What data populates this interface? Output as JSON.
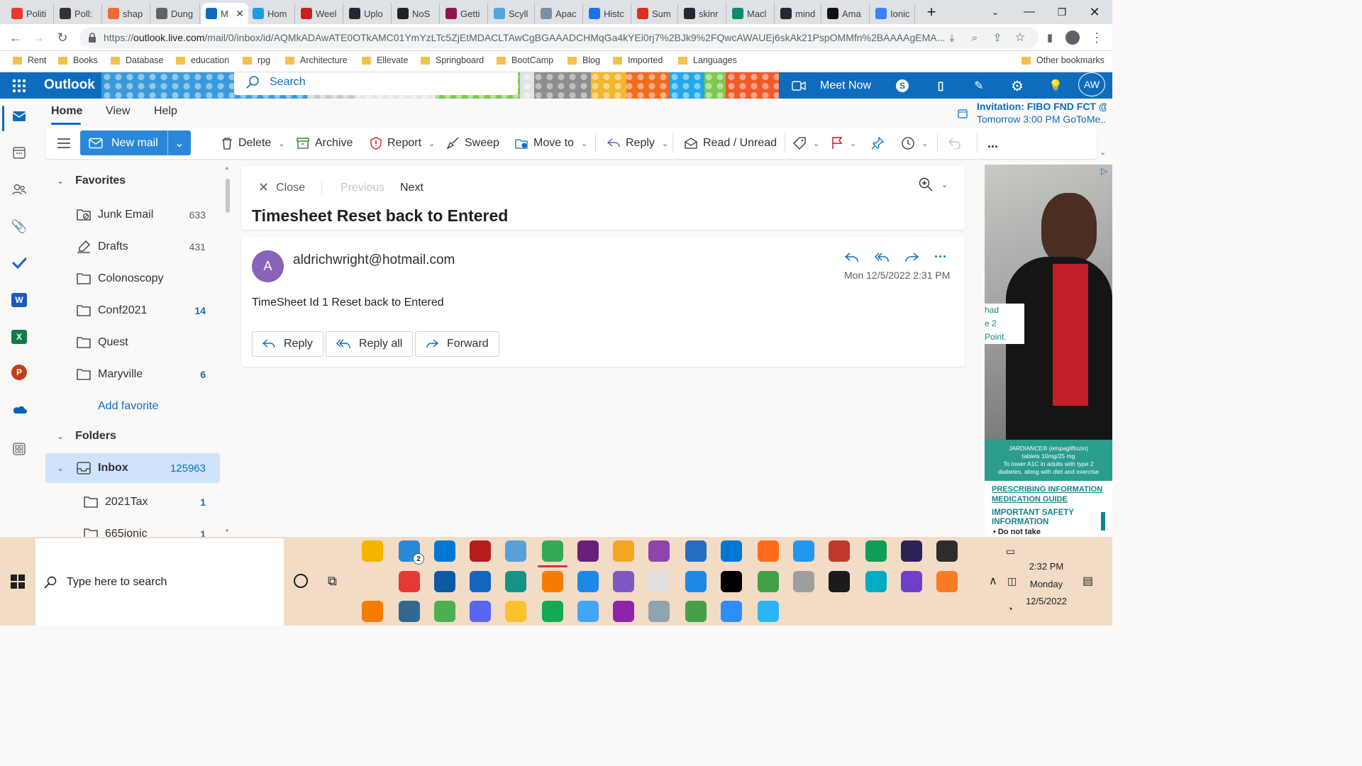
{
  "browser": {
    "tabs": [
      {
        "label": "Politi",
        "favicon": "P",
        "color": "#e63a2e",
        "active": false
      },
      {
        "label": "Poll:",
        "favicon": "hat",
        "color": "#333333",
        "active": false
      },
      {
        "label": "shap",
        "favicon": "e",
        "color": "#ef6b3a",
        "active": false
      },
      {
        "label": "Dung",
        "favicon": "globe",
        "color": "#5f6368",
        "active": false
      },
      {
        "label": "M",
        "favicon": "O",
        "color": "#0f6cbd",
        "active": true
      },
      {
        "label": "Hom",
        "favicon": "cloud",
        "color": "#1b9de2",
        "active": false
      },
      {
        "label": "Weel",
        "favicon": "M",
        "color": "#c5221f",
        "active": false
      },
      {
        "label": "Uplo",
        "favicon": "gh",
        "color": "#24292f",
        "active": false
      },
      {
        "label": "NoS",
        "favicon": "ns",
        "color": "#202124",
        "active": false
      },
      {
        "label": "Getti",
        "favicon": "g",
        "color": "#8b1a4a",
        "active": false
      },
      {
        "label": "Scyll",
        "favicon": "s",
        "color": "#53a6e0",
        "active": false
      },
      {
        "label": "Apac",
        "favicon": "a",
        "color": "#7a8fa6",
        "active": false
      },
      {
        "label": "Histc",
        "favicon": "h",
        "color": "#1a73e8",
        "active": false
      },
      {
        "label": "Sum",
        "favicon": "sum",
        "color": "#d93025",
        "active": false
      },
      {
        "label": "skinr",
        "favicon": "gh",
        "color": "#24292f",
        "active": false
      },
      {
        "label": "Macl",
        "favicon": "m",
        "color": "#0d8a6a",
        "active": false
      },
      {
        "label": "mind",
        "favicon": "gh",
        "color": "#24292f",
        "active": false
      },
      {
        "label": "Ama",
        "favicon": "a",
        "color": "#111111",
        "active": false
      },
      {
        "label": "Ionic",
        "favicon": "i",
        "color": "#3880ff",
        "active": false
      }
    ],
    "url_prefix": "https://",
    "url_host": "outlook.live.com",
    "url_rest": "/mail/0/inbox/id/AQMkADAwATE0OTkAMC01YmYzLTc5ZjEtMDACLTAwCgBGAAADCHMqGa4kYEi0rj7%2BJk9%2FQwcAWAUEj6skAk21PspOMMfn%2BAAAAgEMA...",
    "bookmarks": [
      "Rent",
      "Books",
      "Database",
      "education",
      "rpg",
      "Architecture",
      "Ellevate",
      "Springboard",
      "BootCamp",
      "Blog",
      "Imported",
      "Languages"
    ],
    "other_bookmarks": "Other bookmarks"
  },
  "outlook": {
    "brand": "Outlook",
    "search_placeholder": "Search",
    "meet_now": "Meet Now",
    "avatar_initials": "AW",
    "ribbon_tabs": [
      "Home",
      "View",
      "Help"
    ],
    "invitation_title": "Invitation: FIBO FND FCT @...",
    "invitation_time": "Tomorrow 3:00 PM GoToMe...",
    "toolbar": {
      "new_mail": "New mail",
      "delete": "Delete",
      "archive": "Archive",
      "report": "Report",
      "sweep": "Sweep",
      "move_to": "Move to",
      "reply": "Reply",
      "read_unread": "Read / Unread",
      "more": "..."
    },
    "favorites_header": "Favorites",
    "favorites": [
      {
        "name": "Junk Email",
        "count": "633",
        "unread": false,
        "icon": "junk-folder-icon"
      },
      {
        "name": "Drafts",
        "count": "431",
        "unread": false,
        "icon": "drafts-icon"
      },
      {
        "name": "Colonoscopy",
        "count": "",
        "unread": false,
        "icon": "folder-icon"
      },
      {
        "name": "Conf2021",
        "count": "14",
        "unread": true,
        "icon": "folder-icon"
      },
      {
        "name": "Quest",
        "count": "",
        "unread": false,
        "icon": "folder-icon"
      },
      {
        "name": "Maryville",
        "count": "6",
        "unread": true,
        "icon": "folder-icon"
      }
    ],
    "add_favorite": "Add favorite",
    "folders_header": "Folders",
    "inbox": {
      "name": "Inbox",
      "count": "125963"
    },
    "subfolders": [
      {
        "name": "2021Tax",
        "count": "1"
      },
      {
        "name": "665ionic",
        "count": "1"
      }
    ],
    "reading": {
      "close": "Close",
      "previous": "Previous",
      "next": "Next",
      "subject": "Timesheet Reset back to Entered",
      "sender_initial": "A",
      "sender": "aldrichwright@hotmail.com",
      "date": "Mon 12/5/2022 2:31 PM",
      "body": "TimeSheet Id 1 Reset back to Entered",
      "reply": "Reply",
      "reply_all": "Reply all",
      "forward": "Forward"
    },
    "ad": {
      "fragments": [
        "had",
        "e 2",
        "Point."
      ],
      "drug_line1": "JARDIANCE® (empagliflozin)",
      "drug_line2": "tablets 10mg/25 mg",
      "drug_line3": "To lower A1C in adults with type 2",
      "drug_line4": "diabetes, along with diet and exercise",
      "link1": "PRESCRIBING INFORMATION",
      "link2": "MEDICATION GUIDE",
      "safety1": "IMPORTANT SAFETY",
      "safety2": "INFORMATION",
      "bullet": "Do not take"
    }
  },
  "taskbar": {
    "search_placeholder": "Type here to search",
    "time": "2:32 PM",
    "day": "Monday",
    "date": "12/5/2022",
    "mail_badge": "2"
  }
}
